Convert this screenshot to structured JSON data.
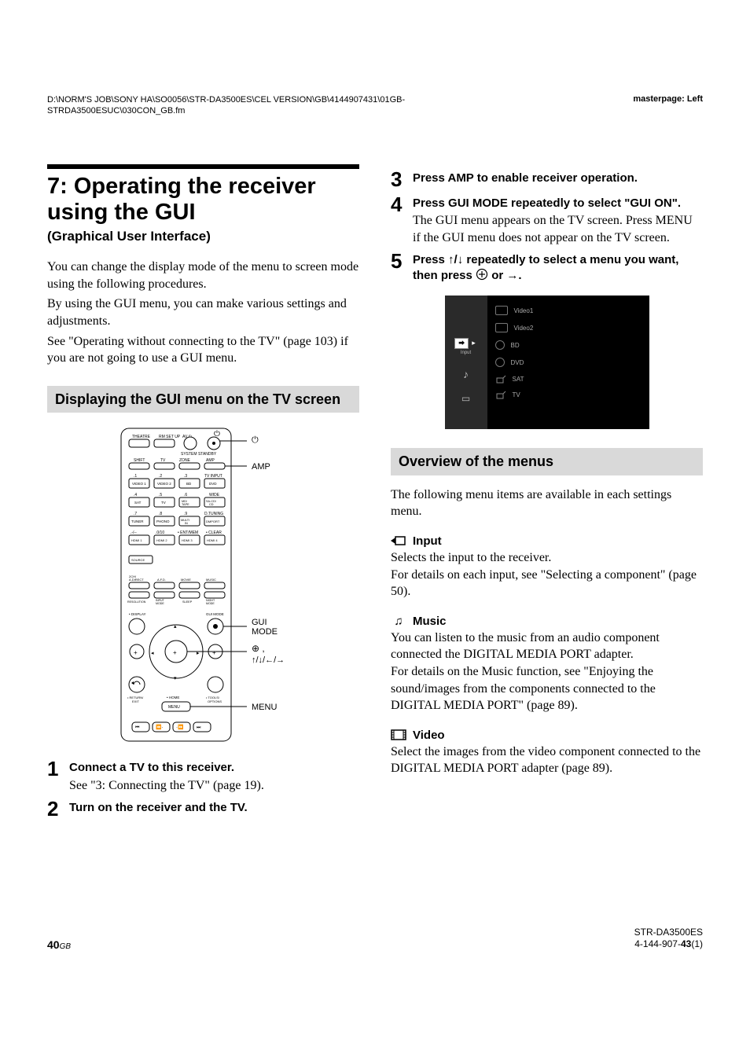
{
  "header": {
    "path": "D:\\NORM'S JOB\\SONY HA\\SO0056\\STR-DA3500ES\\CEL VERSION\\GB\\4144907431\\01GB-STRDA3500ESUC\\030CON_GB.fm",
    "masterpage": "masterpage: Left"
  },
  "left": {
    "section_title": "7: Operating the receiver using the GUI",
    "section_sub": "(Graphical User Interface)",
    "intro_p1": "You can change the display mode of the menu to screen mode using the following procedures.",
    "intro_p2": "By using the GUI menu, you can make various settings and adjustments.",
    "intro_p3": "See \"Operating without connecting to the TV\" (page 103) if you are not going to use a GUI menu.",
    "subhead": "Displaying the GUI menu on the TV screen",
    "remote_labels": {
      "power": "⏻",
      "amp": "AMP",
      "gui": "GUI MODE",
      "enter": "⊕,",
      "arrows": "↑/↓/←/→",
      "menu": "MENU",
      "top_row": [
        "THEATRE",
        "RM SET UP",
        "AV ⏻"
      ],
      "row2": [
        "",
        "",
        "SYSTEM STANDBY"
      ],
      "row3": [
        "SHIFT",
        "TV",
        "ZONE",
        "AMP"
      ],
      "grid_labels": [
        [
          ".1",
          ".2",
          ".3",
          "TV INPUT"
        ],
        [
          "VIDEO 1",
          "VIDEO 2",
          "BD",
          "DVD"
        ],
        [
          ".4",
          ".5",
          ".6",
          ""
        ],
        [
          "SAT",
          "TV",
          "MD/TAPE",
          "SA-CD/CD"
        ],
        [
          ".7",
          ".8",
          ".9",
          "D.TUNING"
        ],
        [
          "TUNER",
          "PHONO",
          "MULTI IN",
          "DMPORT"
        ],
        [
          ".-/--",
          ".0/10",
          "• ENT/MEM",
          "• CLEAR"
        ],
        [
          "HDMI 1",
          "HDMI 2",
          "HDMI 3",
          "HDMI 4"
        ]
      ],
      "source": "SOURCE",
      "mode_row_top": [
        "2CH/A.DIRECT",
        "A.F.D.",
        "MOVIE",
        "MUSIC"
      ],
      "mode_row_bot": [
        "RESOLUTION",
        "INPUT MODE",
        "SLEEP",
        "NIGHT MODE"
      ],
      "display": "• DISPLAY",
      "guimode": "GUI MODE",
      "return": "• RETURN/EXIT",
      "home": "• HOME",
      "tools": "• TOOLS/OPTIONS",
      "menu_btn": "MENU"
    },
    "step1_head": "Connect a TV to this receiver.",
    "step1_body": "See \"3: Connecting the TV\" (page 19).",
    "step2_head": "Turn on the receiver and the TV."
  },
  "right": {
    "step3_head": "Press AMP to enable receiver operation.",
    "step4_head": "Press GUI MODE repeatedly to select \"GUI ON\".",
    "step4_body": "The GUI menu appears on the TV screen. Press MENU if the GUI menu does not appear on the TV screen.",
    "step5_head_a": "Press ",
    "step5_head_b": " repeatedly to select a menu you want, then press ",
    "step5_head_c": " or ",
    "step5_head_d": ".",
    "tv": {
      "sidebar": [
        {
          "icon": "⮕",
          "label": "Input",
          "active": true
        },
        {
          "icon": "♪",
          "label": "",
          "active": false
        },
        {
          "icon": "▭",
          "label": "",
          "active": false
        }
      ],
      "rows": [
        {
          "icon": "rect",
          "label": "Video1"
        },
        {
          "icon": "rect",
          "label": "Video2"
        },
        {
          "icon": "disc",
          "label": "BD"
        },
        {
          "icon": "disc",
          "label": "DVD"
        },
        {
          "icon": "sat",
          "label": "SAT"
        },
        {
          "icon": "sat",
          "label": "TV"
        }
      ]
    },
    "overview_head": "Overview of the menus",
    "overview_intro": "The following menu items are available in each settings menu.",
    "input_head": "Input",
    "input_body": "Selects the input to the receiver.\nFor details on each input, see \"Selecting a component\" (page 50).",
    "music_head": "Music",
    "music_body": "You can listen to the music from an audio component connected the DIGITAL MEDIA PORT adapter.\nFor details on the Music function, see \"Enjoying the sound/images from the components connected to the DIGITAL MEDIA PORT\" (page 89).",
    "video_head": "Video",
    "video_body": "Select the images from the video component connected to the DIGITAL MEDIA PORT adapter (page 89)."
  },
  "footer": {
    "page": "40",
    "suffix": "GB",
    "model": "STR-DA3500ES",
    "code_a": "4-144-907-",
    "code_b": "43",
    "code_c": "(1)"
  }
}
